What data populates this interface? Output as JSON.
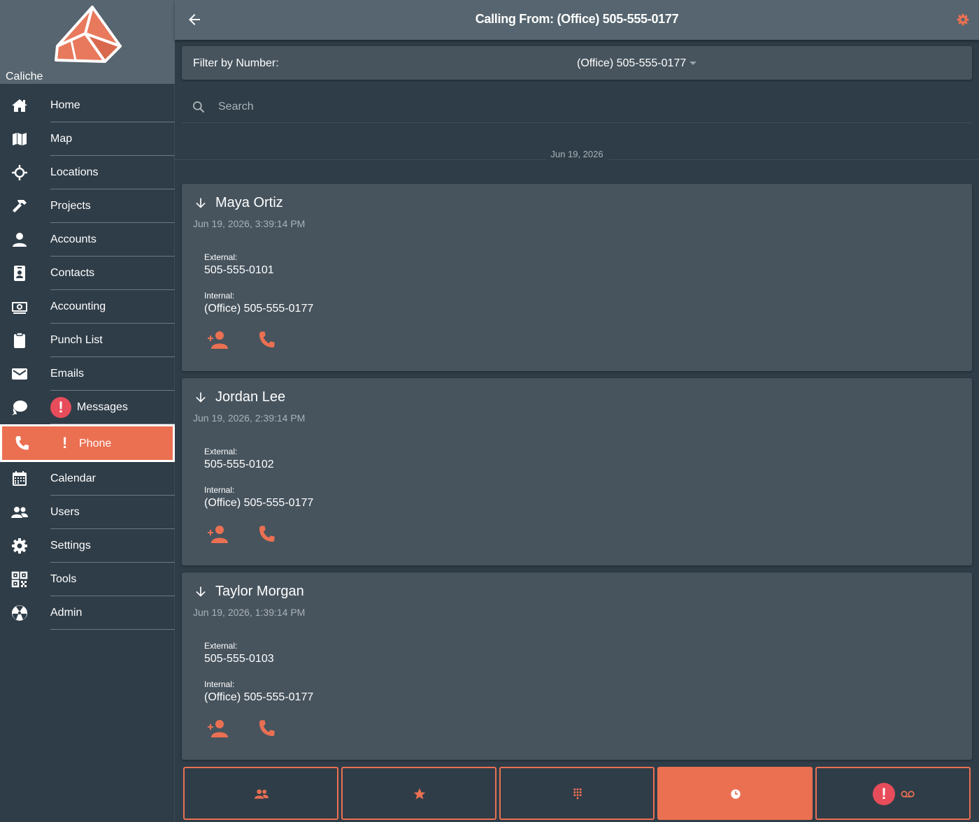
{
  "app": {
    "brand_name": "Caliche",
    "accent_color": "#eb7052",
    "alert_color": "#e74c5a"
  },
  "topbar": {
    "title": "Calling From: (Office) 505-555-0177",
    "back_icon": "arrow-left-icon",
    "settings_icon": "gear-icon"
  },
  "sidebar": {
    "items": [
      {
        "label": "Home",
        "icon": "home-icon"
      },
      {
        "label": "Map",
        "icon": "map-icon"
      },
      {
        "label": "Locations",
        "icon": "crosshair-icon"
      },
      {
        "label": "Projects",
        "icon": "hammer-icon"
      },
      {
        "label": "Accounts",
        "icon": "person-icon"
      },
      {
        "label": "Contacts",
        "icon": "contact-card-icon"
      },
      {
        "label": "Accounting",
        "icon": "money-icon"
      },
      {
        "label": "Punch List",
        "icon": "clipboard-icon"
      },
      {
        "label": "Emails",
        "icon": "envelope-icon"
      },
      {
        "label": "Messages",
        "icon": "chat-icon",
        "badge": "!"
      },
      {
        "label": "Phone",
        "icon": "phone-icon",
        "badge": "!",
        "active": true
      },
      {
        "label": "Calendar",
        "icon": "calendar-icon"
      },
      {
        "label": "Users",
        "icon": "users-icon"
      },
      {
        "label": "Settings",
        "icon": "gear-icon"
      },
      {
        "label": "Tools",
        "icon": "qr-icon"
      },
      {
        "label": "Admin",
        "icon": "radiation-icon"
      }
    ]
  },
  "filter": {
    "label": "Filter by Number:",
    "selected": "(Office) 505-555-0177"
  },
  "search": {
    "placeholder": "Search",
    "value": ""
  },
  "date_separator": "Jun 19, 2026",
  "calls": [
    {
      "name": "Maya Ortiz",
      "time": "Jun 19, 2026, 3:39:14 PM",
      "external_label": "External:",
      "external": "505-555-0101",
      "internal_label": "Internal:",
      "internal": "(Office) 505-555-0177",
      "direction": "incoming"
    },
    {
      "name": "Jordan Lee",
      "time": "Jun 19, 2026, 2:39:14 PM",
      "external_label": "External:",
      "external": "505-555-0102",
      "internal_label": "Internal:",
      "internal": "(Office) 505-555-0177",
      "direction": "incoming"
    },
    {
      "name": "Taylor Morgan",
      "time": "Jun 19, 2026, 1:39:14 PM",
      "external_label": "External:",
      "external": "505-555-0103",
      "internal_label": "Internal:",
      "internal": "(Office) 505-555-0177",
      "direction": "incoming"
    }
  ],
  "tabs": [
    {
      "icon": "contacts-icon"
    },
    {
      "icon": "star-icon"
    },
    {
      "icon": "dialpad-icon"
    },
    {
      "icon": "clock-icon",
      "active": true
    },
    {
      "icon": "voicemail-icon",
      "badge": "!"
    }
  ]
}
